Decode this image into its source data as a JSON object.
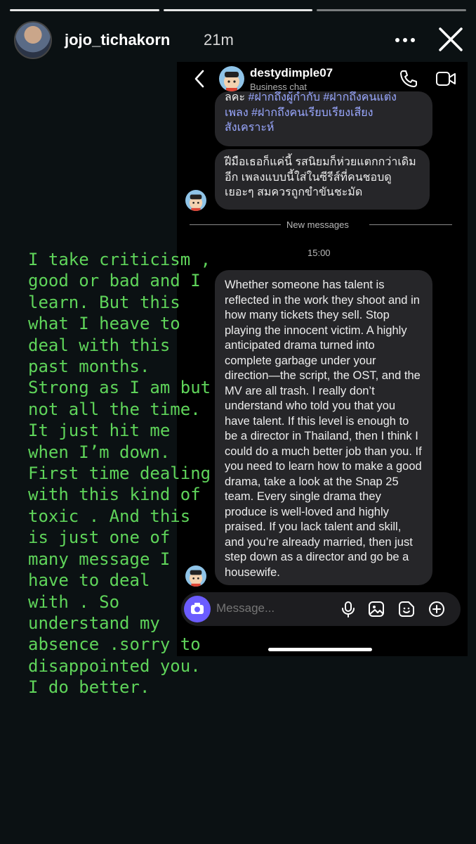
{
  "story": {
    "username": "jojo_tichakorn",
    "time_ago": "21m",
    "progress_segments": 3,
    "progress_completed": 2,
    "icons": {
      "more": "more-dots-icon",
      "close": "close-icon"
    }
  },
  "chat": {
    "contact_name": "destydimple07",
    "contact_subtitle": "Business chat",
    "icons": {
      "back": "chevron-left-icon",
      "call": "phone-icon",
      "video": "video-camera-icon"
    },
    "messages": [
      {
        "parts": [
          {
            "text": "ลคะ ",
            "hashtag": false
          },
          {
            "text": "#ฝากถึงผู้กำกับ #ฝากถึงคนแต่ง เพลง #ฝากถึงคนเรียบเรียงเสียง สังเคราะห์",
            "hashtag": true
          }
        ]
      },
      {
        "text": "ฝีมือเธอก็แค่นี้ รสนิยมก็ห่วยแตกกว่าเดิมอีก เพลงแบบนี้ใส่ในซีรีส์ที่คนชอบดูเยอะๆ สมควรถูกขำขันชะมัด"
      },
      {
        "text": "Whether someone has talent is reflected in the work they shoot and in how many tickets they sell. Stop playing the innocent victim. A highly anticipated drama turned into complete garbage under your direction—the script, the OST, and the MV are all trash. I really don’t understand who told you that you have talent. If this level is enough to be a director in Thailand, then I think I could do a much better job than you. If you need to learn how to make a good drama, take a look at the Snap 25 team. Every single drama they produce is well-loved and highly praised. If you lack talent and skill, and you’re already married, then just step down as a director and go be a housewife."
      }
    ],
    "new_messages_label": "New messages",
    "timestamp": "15:00",
    "composer": {
      "placeholder": "Message...",
      "icons": [
        "camera-icon",
        "microphone-icon",
        "gallery-icon",
        "sticker-icon",
        "plus-circle-icon"
      ]
    },
    "colors": {
      "bubble": "#262629",
      "hashtag": "#9aa8ff",
      "camera": "#6b5cff"
    }
  },
  "caption": {
    "lines": [
      "I take criticism ,",
      "good or bad and I",
      "learn. But this",
      "what I heave to",
      "deal with this",
      "past months.",
      "Strong as I am but",
      "not all the time.",
      "It just hit me",
      "when I’m down.",
      "First time dealing",
      "with this kind of",
      "toxic . And this",
      "is just one of",
      "many message I",
      "have to deal",
      "with . So",
      "understand my",
      "absence .sorry to",
      "disappointed you.",
      "I do better."
    ],
    "color": "#5fd45a"
  }
}
